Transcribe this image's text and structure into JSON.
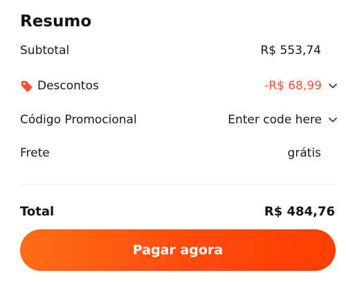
{
  "summary": {
    "title": "Resumo",
    "subtotal": {
      "label": "Subtotal",
      "value": "R$ 553,74"
    },
    "discounts": {
      "label": "Descontos",
      "value": "-R$ 68,99",
      "icon": "tag-icon",
      "color": "#fd4f2b"
    },
    "promo": {
      "label": "Código Promocional",
      "value": "Enter code here"
    },
    "shipping": {
      "label": "Frete",
      "value": "grátis"
    },
    "total": {
      "label": "Total",
      "value": "R$ 484,76"
    },
    "pay_button_label": "Pagar agora",
    "accent_color": "#ff4a0c"
  }
}
